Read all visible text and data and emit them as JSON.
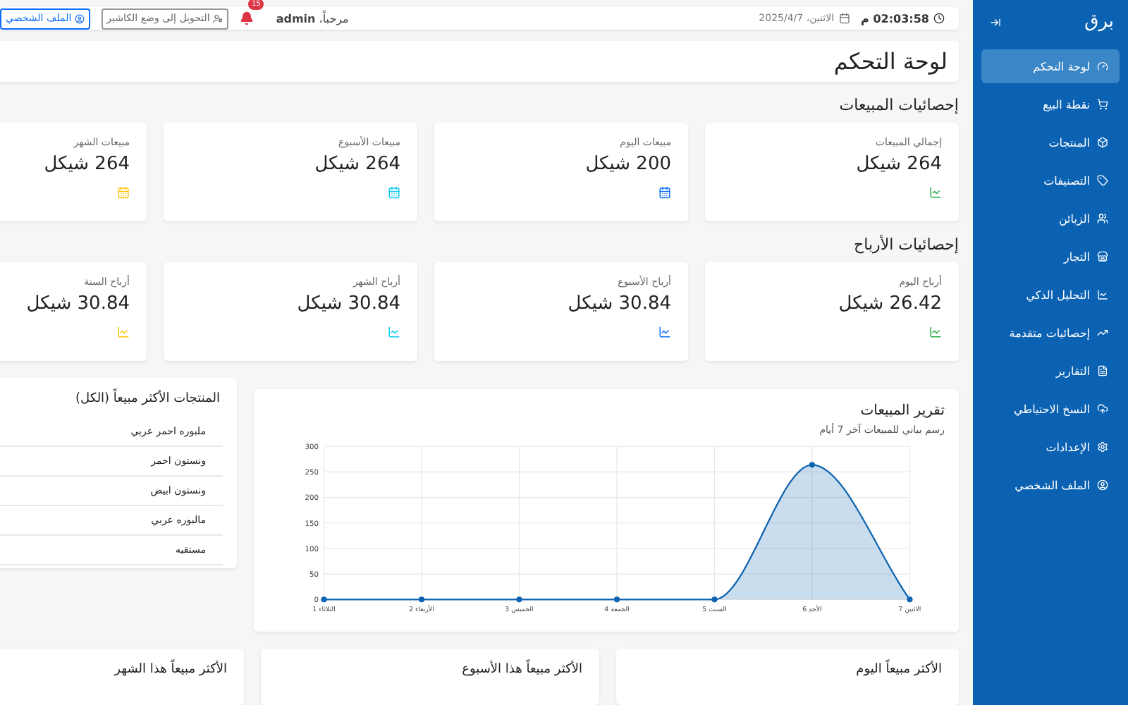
{
  "sidebar": {
    "brand": "برق",
    "items": [
      {
        "label": "لوحة التحكم",
        "selected": true
      },
      {
        "label": "نقطة البيع",
        "selected": false
      },
      {
        "label": "المنتجات",
        "selected": false
      },
      {
        "label": "التصنيفات",
        "selected": false
      },
      {
        "label": "الزبائن",
        "selected": false
      },
      {
        "label": "التجار",
        "selected": false
      },
      {
        "label": "التحليل الذكي",
        "selected": false
      },
      {
        "label": "إحصائيات متقدمة",
        "selected": false
      },
      {
        "label": "التقارير",
        "selected": false
      },
      {
        "label": "النسخ الاحتياطي",
        "selected": false
      },
      {
        "label": "الإعدادات",
        "selected": false
      },
      {
        "label": "الملف الشخصي",
        "selected": false
      }
    ]
  },
  "header": {
    "time": "02:03:58 م",
    "date": "الاثنين، 2025/4/7",
    "greeting": "مرحباً، **admin**",
    "notification_count": "15",
    "cashier_button": "التحويل إلى وضع الكاشير",
    "profile_button": "الملف الشخصي"
  },
  "page_title": "لوحة التحكم",
  "sales_stats": {
    "title": "إحصائيات المبيعات",
    "cards": [
      {
        "label": "إجمالي المبيعات",
        "value": "264 شيكل",
        "kind": "chart",
        "color": "#28a745"
      },
      {
        "label": "مبيعات اليوم",
        "value": "200 شيكل",
        "kind": "calendar",
        "color": "#0d6efd"
      },
      {
        "label": "مبيعات الأسبوع",
        "value": "264 شيكل",
        "kind": "calendar",
        "color": "#0dcaf0"
      },
      {
        "label": "مبيعات الشهر",
        "value": "264 شيكل",
        "kind": "calendar",
        "color": "#ffc107"
      }
    ]
  },
  "profit_stats": {
    "title": "إحصائيات الأرباح",
    "cards": [
      {
        "label": "أرباح اليوم",
        "value": "26.42 شيكل",
        "kind": "chart",
        "color": "#28a745"
      },
      {
        "label": "أرباح الأسبوع",
        "value": "30.84 شيكل",
        "kind": "chart",
        "color": "#0d6efd"
      },
      {
        "label": "أرباح الشهر",
        "value": "30.84 شيكل",
        "kind": "chart",
        "color": "#0dcaf0"
      },
      {
        "label": "أرباح السنة",
        "value": "30.84 شيكل",
        "kind": "chart",
        "color": "#ffc107"
      }
    ]
  },
  "sales_report": {
    "title": "تقرير المبيعات",
    "subtitle": "رسم بياني للمبيعات آخر 7 أيام",
    "chart_data": {
      "type": "area",
      "categories": [
        "الثلاثاء 1",
        "الأربعاء 2",
        "الخميس 3",
        "الجمعة 4",
        "السبت 5",
        "الأحد 6",
        "الاثنين 7"
      ],
      "series": [
        {
          "color": "#0d63b0",
          "values": [
            0,
            0,
            0,
            0,
            0,
            264,
            0
          ]
        }
      ],
      "grid": true,
      "ylim": [
        0,
        300
      ],
      "yticks": [
        0,
        50,
        100,
        150,
        200,
        250,
        300
      ]
    }
  },
  "top_products_all": {
    "title": "المنتجات الأكثر مبيعاً (الكل)",
    "items": [
      "ملبوره احمر عربي",
      "ونستون احمر",
      "ونستون ابيض",
      "مالبوره عربي",
      "مستقيه"
    ]
  },
  "top_sellers": [
    {
      "title": "الأكثر مبيعاً اليوم"
    },
    {
      "title": "الأكثر مبيعاً هذا الأسبوع"
    },
    {
      "title": "الأكثر مبيعاً هذا الشهر"
    }
  ]
}
